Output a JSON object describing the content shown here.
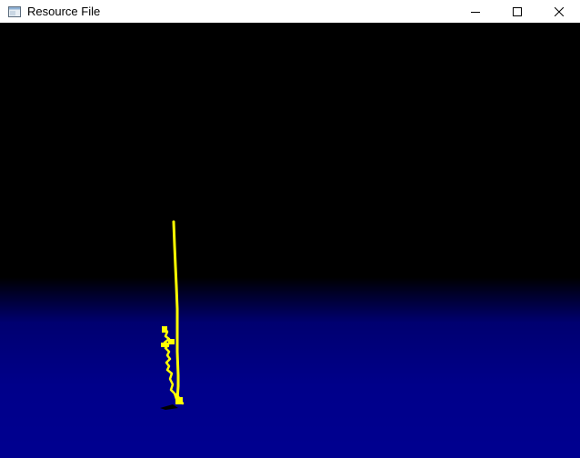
{
  "window": {
    "title": "Resource File"
  },
  "controls": {
    "minimize_icon": "minimize-icon",
    "maximize_icon": "maximize-icon",
    "close_icon": "close-icon"
  },
  "scene": {
    "sky_color": "#000000",
    "ground_color": "#00008a",
    "stroke_color": "#ffff00",
    "shadow_color": "#000000"
  }
}
